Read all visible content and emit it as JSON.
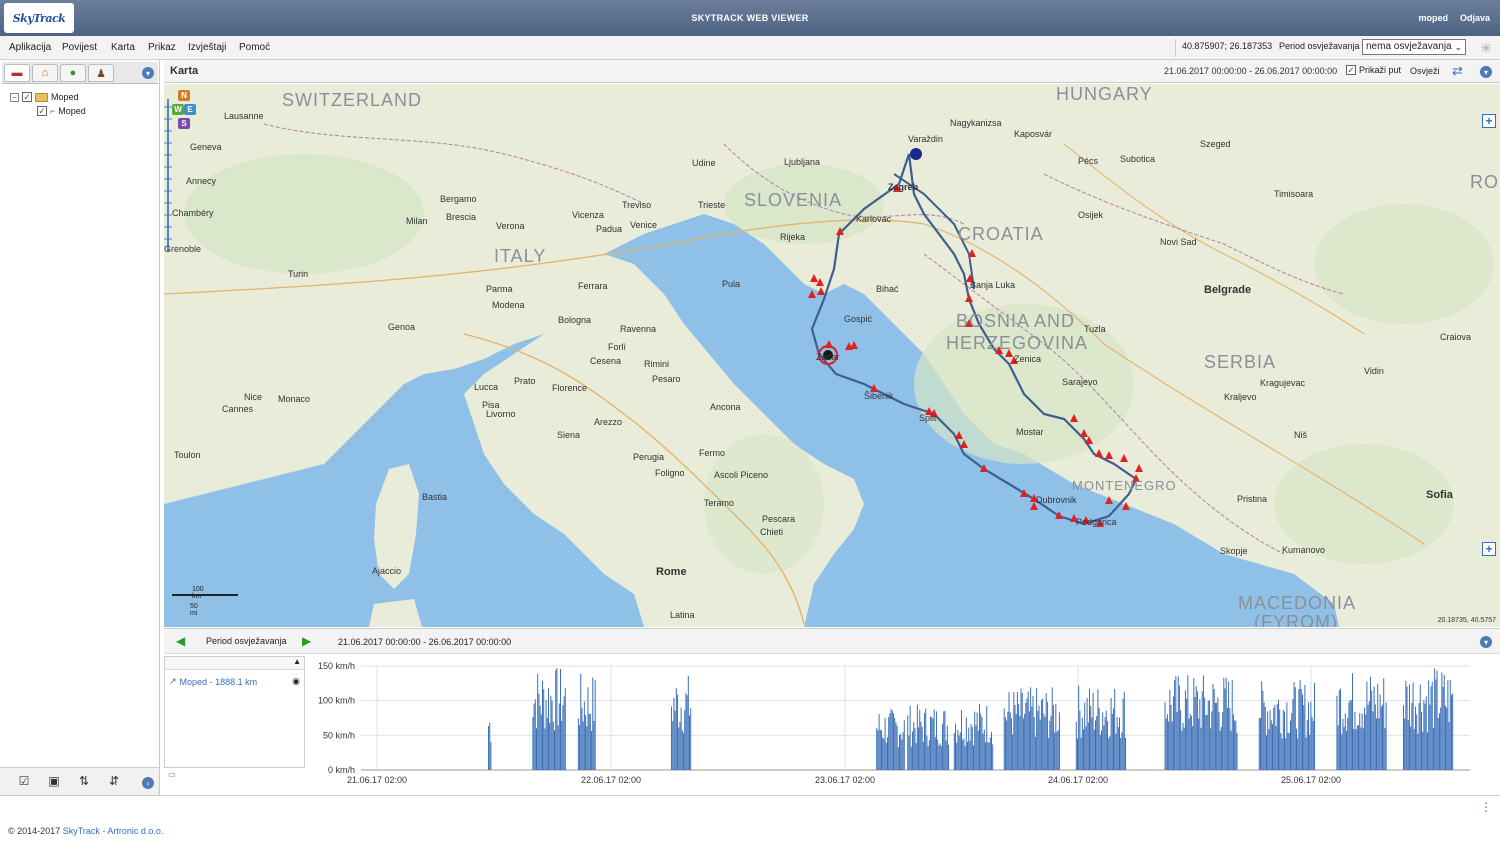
{
  "header": {
    "logo_text": "SkyTrack",
    "app_title": "SKYTRACK WEB VIEWER",
    "user": "moped",
    "logout": "Odjava"
  },
  "menu": {
    "items": [
      "Aplikacija",
      "Povijest",
      "Karta",
      "Prikaz",
      "Izvještaji",
      "Pomoć"
    ],
    "coordinates": "40.875907; 26.187353",
    "period_label": "Period osvježavanja",
    "period_value": "nema osvježavanja"
  },
  "left_panel": {
    "tree": {
      "group_label": "Moped",
      "vehicle_label": "Moped"
    }
  },
  "map_panel": {
    "title": "Karta",
    "date_range": "21.06.2017 00:00:00 - 26.06.2017 00:00:00",
    "show_path_label": "Prikaži put",
    "show_path_checked": true,
    "refresh_label": "Osvježi",
    "scale_km": "100 km",
    "scale_mi": "50 mi",
    "corner_coords": "20.18735, 40.5757",
    "nav_badges": [
      "N",
      "W",
      "E",
      "S"
    ],
    "countries": [
      "SWITZERLAND",
      "HUNGARY",
      "SLOVENIA",
      "CROATIA",
      "ITALY",
      "BOSNIA AND",
      "HERZEGOVINA",
      "SERBIA",
      "MONTENEGRO",
      "MACEDONIA",
      "(FYROM)",
      "RO"
    ],
    "cities": [
      "Lausanne",
      "Geneva",
      "Annecy",
      "Chambéry",
      "Grenoble",
      "Turin",
      "Milan",
      "Bergamo",
      "Brescia",
      "Verona",
      "Vicenza",
      "Padua",
      "Venice",
      "Treviso",
      "Trieste",
      "Udine",
      "Ljubljana",
      "Zagreb",
      "Rijeka",
      "Karlovac",
      "Bologna",
      "Genoa",
      "Parma",
      "Modena",
      "Ferrara",
      "Ravenna",
      "Rimini",
      "Forlì",
      "Cesena",
      "Pesaro",
      "Ancona",
      "Florence",
      "Prato",
      "Pisa",
      "Livorno",
      "Lucca",
      "Siena",
      "Arezzo",
      "Perugia",
      "Foligno",
      "Rome",
      "Latina",
      "Pescara",
      "Chieti",
      "Teramo",
      "Ascoli Piceno",
      "Fermo",
      "Nice",
      "Monaco",
      "Cannes",
      "Toulon",
      "Bastia",
      "Ajaccio",
      "Zadar",
      "Split",
      "Šibenik",
      "Dubrovnik",
      "Mostar",
      "Sarajevo",
      "Banja Luka",
      "Osijek",
      "Novi Sad",
      "Belgrade",
      "Podgorica",
      "Pécs",
      "Szeged",
      "Subotica",
      "Timisoara",
      "Kragujevac",
      "Niš",
      "Skopje",
      "Sofia",
      "Pristina",
      "Kraljevo",
      "Craiova",
      "Vidin",
      "Kumanovo",
      "Nagykanizsa",
      "Kaposvár",
      "Varaždin",
      "Bihać",
      "Zenica",
      "Tuzla",
      "Pula",
      "Gospić"
    ],
    "route_markers_count": 42
  },
  "chart_panel": {
    "period_label": "Period osvježavanja",
    "date_range": "21.06.2017 00:00:00 - 26.06.2017 00:00:00",
    "legend_label": "Moped - 1888.1 km"
  },
  "chart_data": {
    "type": "bar",
    "title": "",
    "ylabel": "",
    "y_ticks": [
      "0 km/h",
      "50 km/h",
      "100 km/h",
      "150 km/h"
    ],
    "ylim": [
      0,
      150
    ],
    "x_ticks": [
      "21.06.17 02:00",
      "22.06.17 02:00",
      "23.06.17 02:00",
      "24.06.17 02:00",
      "25.06.17 02:00"
    ],
    "series": [
      {
        "color": "#3b6fb8",
        "bursts": [
          {
            "start": 0.115,
            "end": 0.118,
            "peak": 95
          },
          {
            "start": 0.155,
            "end": 0.185,
            "peak": 150
          },
          {
            "start": 0.196,
            "end": 0.212,
            "peak": 140
          },
          {
            "start": 0.28,
            "end": 0.298,
            "peak": 140
          },
          {
            "start": 0.465,
            "end": 0.49,
            "peak": 90
          },
          {
            "start": 0.493,
            "end": 0.53,
            "peak": 95
          },
          {
            "start": 0.535,
            "end": 0.57,
            "peak": 100
          },
          {
            "start": 0.58,
            "end": 0.63,
            "peak": 120
          },
          {
            "start": 0.645,
            "end": 0.69,
            "peak": 125
          },
          {
            "start": 0.725,
            "end": 0.79,
            "peak": 140
          },
          {
            "start": 0.81,
            "end": 0.86,
            "peak": 130
          },
          {
            "start": 0.88,
            "end": 0.925,
            "peak": 145
          },
          {
            "start": 0.94,
            "end": 0.985,
            "peak": 150
          }
        ]
      }
    ]
  },
  "footer": {
    "copyright_prefix": "© 2014-2017 ",
    "company": "SkyTrack - Artronic d.o.o."
  }
}
